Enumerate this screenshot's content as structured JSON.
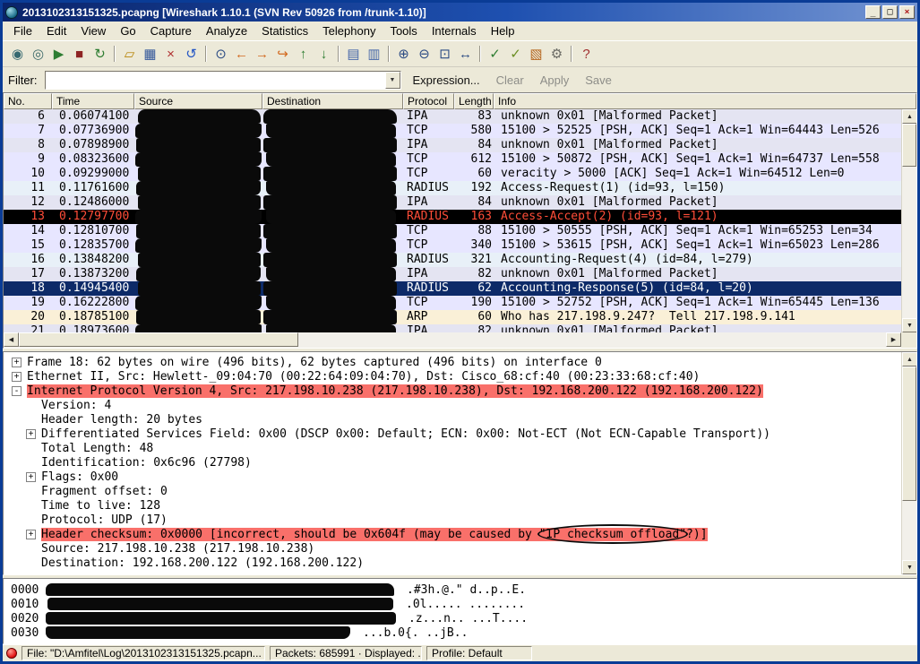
{
  "window": {
    "title": "2013102313151325.pcapng  [Wireshark 1.10.1  (SVN Rev 50926 from /trunk-1.10)]",
    "controls": {
      "minimize": "_",
      "maximize": "□",
      "close": "×"
    }
  },
  "menu": [
    "File",
    "Edit",
    "View",
    "Go",
    "Capture",
    "Analyze",
    "Statistics",
    "Telephony",
    "Tools",
    "Internals",
    "Help"
  ],
  "toolbar": [
    {
      "name": "list-interfaces",
      "glyph": "◉",
      "color": "#356870"
    },
    {
      "name": "capture-options",
      "glyph": "◎",
      "color": "#3d6a6a"
    },
    {
      "name": "start-capture",
      "glyph": "▶",
      "color": "#2e7d32"
    },
    {
      "name": "stop-capture",
      "glyph": "■",
      "color": "#8e2424"
    },
    {
      "name": "restart-capture",
      "glyph": "↻",
      "color": "#2e7d32"
    },
    {
      "sep": true
    },
    {
      "name": "open-file",
      "glyph": "▱",
      "color": "#b8860b"
    },
    {
      "name": "save-file",
      "glyph": "▦",
      "color": "#33579a"
    },
    {
      "name": "close-file",
      "glyph": "×",
      "color": "#b03030"
    },
    {
      "name": "reload-file",
      "glyph": "↺",
      "color": "#2456c4"
    },
    {
      "sep": true
    },
    {
      "name": "find-packet",
      "glyph": "⊙",
      "color": "#2c4c84"
    },
    {
      "name": "go-back",
      "glyph": "←",
      "color": "#d2691e"
    },
    {
      "name": "go-forward",
      "glyph": "→",
      "color": "#d2691e"
    },
    {
      "name": "go-to-packet",
      "glyph": "↪",
      "color": "#d2691e"
    },
    {
      "name": "go-first",
      "glyph": "↑",
      "color": "#2e7d32"
    },
    {
      "name": "go-last",
      "glyph": "↓",
      "color": "#2e7d32"
    },
    {
      "sep": true
    },
    {
      "name": "colorize-toggle",
      "glyph": "▤",
      "color": "#4466a8"
    },
    {
      "name": "autoscroll-toggle",
      "glyph": "▥",
      "color": "#4466a8"
    },
    {
      "sep": true
    },
    {
      "name": "zoom-in",
      "glyph": "⊕",
      "color": "#2c4c84"
    },
    {
      "name": "zoom-out",
      "glyph": "⊖",
      "color": "#2c4c84"
    },
    {
      "name": "zoom-normal",
      "glyph": "⊡",
      "color": "#2c4c84"
    },
    {
      "name": "resize-columns",
      "glyph": "↔",
      "color": "#2c4c84"
    },
    {
      "sep": true
    },
    {
      "name": "capture-filters",
      "glyph": "✓",
      "color": "#2e7d32"
    },
    {
      "name": "display-filters",
      "glyph": "✓",
      "color": "#6b8e23"
    },
    {
      "name": "coloring-rules",
      "glyph": "▧",
      "color": "#b5651d"
    },
    {
      "name": "preferences",
      "glyph": "⚙",
      "color": "#6a6a64"
    },
    {
      "sep": true
    },
    {
      "name": "help",
      "glyph": "?",
      "color": "#a03030"
    }
  ],
  "filter": {
    "label": "Filter:",
    "value": "",
    "dropdown": "▼",
    "expression": "Expression...",
    "clear": "Clear",
    "apply": "Apply",
    "save": "Save"
  },
  "packet_list": {
    "columns": [
      "No.",
      "Time",
      "Source",
      "Destination",
      "Protocol",
      "Length",
      "Info"
    ],
    "rows": [
      {
        "no": "6",
        "time": "0.06074100",
        "protocol": "IPA",
        "length": "83",
        "info": "unknown 0x01 [Malformed Packet]",
        "type": "ipa"
      },
      {
        "no": "7",
        "time": "0.07736900",
        "protocol": "TCP",
        "length": "580",
        "info": "15100 > 52525 [PSH, ACK] Seq=1 Ack=1 Win=64443 Len=526",
        "type": "tcp"
      },
      {
        "no": "8",
        "time": "0.07898900",
        "protocol": "IPA",
        "length": "84",
        "info": "unknown 0x01 [Malformed Packet]",
        "type": "ipa"
      },
      {
        "no": "9",
        "time": "0.08323600",
        "protocol": "TCP",
        "length": "612",
        "info": "15100 > 50872 [PSH, ACK] Seq=1 Ack=1 Win=64737 Len=558",
        "type": "tcp"
      },
      {
        "no": "10",
        "time": "0.09299000",
        "protocol": "TCP",
        "length": "60",
        "info": "veracity > 5000 [ACK] Seq=1 Ack=1 Win=64512 Len=0",
        "type": "tcp"
      },
      {
        "no": "11",
        "time": "0.11761600",
        "protocol": "RADIUS",
        "length": "192",
        "info": "Access-Request(1) (id=93, l=150)",
        "type": "radius"
      },
      {
        "no": "12",
        "time": "0.12486000",
        "protocol": "IPA",
        "length": "84",
        "info": "unknown 0x01 [Malformed Packet]",
        "type": "ipa"
      },
      {
        "no": "13",
        "time": "0.12797700",
        "protocol": "RADIUS",
        "length": "163",
        "info": "Access-Accept(2) (id=93, l=121)",
        "type": "error"
      },
      {
        "no": "14",
        "time": "0.12810700",
        "protocol": "TCP",
        "length": "88",
        "info": "15100 > 50555 [PSH, ACK] Seq=1 Ack=1 Win=65253 Len=34",
        "type": "tcp"
      },
      {
        "no": "15",
        "time": "0.12835700",
        "protocol": "TCP",
        "length": "340",
        "info": "15100 > 53615 [PSH, ACK] Seq=1 Ack=1 Win=65023 Len=286",
        "type": "tcp"
      },
      {
        "no": "16",
        "time": "0.13848200",
        "protocol": "RADIUS",
        "length": "321",
        "info": "Accounting-Request(4) (id=84, l=279)",
        "type": "radius"
      },
      {
        "no": "17",
        "time": "0.13873200",
        "protocol": "IPA",
        "length": "82",
        "info": "unknown 0x01 [Malformed Packet]",
        "type": "ipa"
      },
      {
        "no": "18",
        "time": "0.14945400",
        "protocol": "RADIUS",
        "length": "62",
        "info": "Accounting-Response(5) (id=84, l=20)",
        "type": "selected"
      },
      {
        "no": "19",
        "time": "0.16222800",
        "protocol": "TCP",
        "length": "190",
        "info": "15100 > 52752 [PSH, ACK] Seq=1 Ack=1 Win=65445 Len=136",
        "type": "tcp"
      },
      {
        "no": "20",
        "time": "0.18785100",
        "protocol": "ARP",
        "length": "60",
        "info": "Who has 217.198.9.247?  Tell 217.198.9.141",
        "type": "arp"
      },
      {
        "no": "21",
        "time": "0.18973600",
        "protocol": "IPA",
        "length": "82",
        "info": "unknown 0x01 [Malformed Packet]",
        "type": "ipa"
      }
    ]
  },
  "details": [
    {
      "indent": 0,
      "expander": "plus",
      "error": false,
      "text": "Frame 18: 62 bytes on wire (496 bits), 62 bytes captured (496 bits) on interface 0"
    },
    {
      "indent": 0,
      "expander": "plus",
      "error": false,
      "text": "Ethernet II, Src: Hewlett-_09:04:70 (00:22:64:09:04:70), Dst: Cisco_68:cf:40 (00:23:33:68:cf:40)"
    },
    {
      "indent": 0,
      "expander": "minus",
      "error": true,
      "text": "Internet Protocol Version 4, Src: 217.198.10.238 (217.198.10.238), Dst: 192.168.200.122 (192.168.200.122)"
    },
    {
      "indent": 1,
      "expander": null,
      "error": false,
      "text": "Version: 4"
    },
    {
      "indent": 1,
      "expander": null,
      "error": false,
      "text": "Header length: 20 bytes"
    },
    {
      "indent": 1,
      "expander": "plus",
      "error": false,
      "text": "Differentiated Services Field: 0x00 (DSCP 0x00: Default; ECN: 0x00: Not-ECT (Not ECN-Capable Transport))"
    },
    {
      "indent": 1,
      "expander": null,
      "error": false,
      "text": "Total Length: 48"
    },
    {
      "indent": 1,
      "expander": null,
      "error": false,
      "text": "Identification: 0x6c96 (27798)"
    },
    {
      "indent": 1,
      "expander": "plus",
      "error": false,
      "text": "Flags: 0x00"
    },
    {
      "indent": 1,
      "expander": null,
      "error": false,
      "text": "Fragment offset: 0"
    },
    {
      "indent": 1,
      "expander": null,
      "error": false,
      "text": "Time to live: 128"
    },
    {
      "indent": 1,
      "expander": null,
      "error": false,
      "text": "Protocol: UDP (17)"
    },
    {
      "indent": 1,
      "expander": "plus",
      "error": true,
      "text": "Header checksum: 0x0000 [incorrect, should be 0x604f (may be caused by \"IP checksum offload\"?)]"
    },
    {
      "indent": 1,
      "expander": null,
      "error": false,
      "text": "Source: 217.198.10.238 (217.198.10.238)"
    },
    {
      "indent": 1,
      "expander": null,
      "error": false,
      "text": "Destination: 192.168.200.122 (192.168.200.122)"
    }
  ],
  "hex": [
    {
      "offset": "0000",
      "ascii": ".#3h.@.\" d..p..E."
    },
    {
      "offset": "0010",
      "ascii": ".0l..... ........"
    },
    {
      "offset": "0020",
      "ascii": ".z...n.. ...T...."
    },
    {
      "offset": "0030",
      "ascii": "...b.0{. ..jB.."
    }
  ],
  "statusbar": {
    "file": "File: \"D:\\Amfitel\\Log\\2013102313151325.pcapn...",
    "packets": "Packets: 685991 · Displayed: ...",
    "profile": "Profile: Default"
  }
}
